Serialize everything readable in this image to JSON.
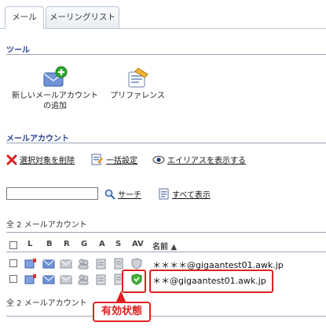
{
  "tabs": [
    {
      "label": "メール",
      "active": true
    },
    {
      "label": "メーリングリスト",
      "active": false
    }
  ],
  "tools": {
    "title": "ツール",
    "items": [
      {
        "label_line1": "新しいメールアカウント",
        "label_line2": "の追加",
        "icon": "mail-add-icon"
      },
      {
        "label_line1": "プリファレンス",
        "label_line2": "",
        "icon": "preferences-icon"
      }
    ]
  },
  "accounts": {
    "title": "メールアカウント",
    "actions": [
      {
        "label": "選択対象を削除",
        "icon": "delete-x-icon"
      },
      {
        "label": "一括設定",
        "icon": "bulk-settings-icon"
      },
      {
        "label": "エイリアスを表示する",
        "icon": "eye-icon"
      }
    ],
    "search": {
      "value": "",
      "button": "サーチ",
      "show_all": "すべて表示"
    },
    "count_top": "全 2 メールアカウント",
    "count_bottom": "全 2 メールアカウント",
    "columns": [
      "L",
      "B",
      "R",
      "G",
      "A",
      "S",
      "AV",
      "名前 ▲"
    ],
    "rows": [
      {
        "address": "＊＊＊＊@gigaantest01.awk.jp",
        "av_active": false
      },
      {
        "address": "＊＊@gigaantest01.awk.jp",
        "av_active": true
      }
    ]
  },
  "annotation": {
    "label": "有効状態"
  },
  "colors": {
    "section_title": "#2a3f8f",
    "highlight": "#e02020"
  }
}
